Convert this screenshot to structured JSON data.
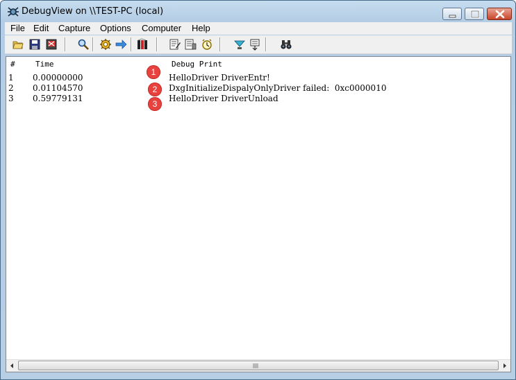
{
  "window": {
    "title": "DebugView on \\\\TEST-PC (local)"
  },
  "menu": [
    "File",
    "Edit",
    "Capture",
    "Options",
    "Computer",
    "Help"
  ],
  "toolbar": [
    {
      "name": "open-icon"
    },
    {
      "name": "save-icon"
    },
    {
      "name": "clear-display-icon"
    },
    {
      "name": "find-icon"
    },
    {
      "name": "capture-icon"
    },
    {
      "name": "autoscroll-icon"
    },
    {
      "name": "history-icon"
    },
    {
      "name": "highlight-icon"
    },
    {
      "name": "filter-icon"
    },
    {
      "name": "clock-icon"
    },
    {
      "name": "capture-kernel-icon"
    },
    {
      "name": "pass-through-icon"
    },
    {
      "name": "binoculars-icon"
    }
  ],
  "columns": [
    "#",
    "Time",
    "Debug Print"
  ],
  "rows": [
    {
      "num": "1",
      "time": "0.00000000",
      "msg": "HelloDriver DriverEntr!"
    },
    {
      "num": "2",
      "time": "0.01104570",
      "msg": "DxgInitializeDispalyOnlyDriver failed:  0xc0000010"
    },
    {
      "num": "3",
      "time": "0.59779131",
      "msg": "HelloDriver DriverUnload"
    }
  ],
  "badges": [
    "1",
    "2",
    "3"
  ],
  "colors": {
    "badge": "#e8423f",
    "titlebar": "#b9d1ea"
  }
}
